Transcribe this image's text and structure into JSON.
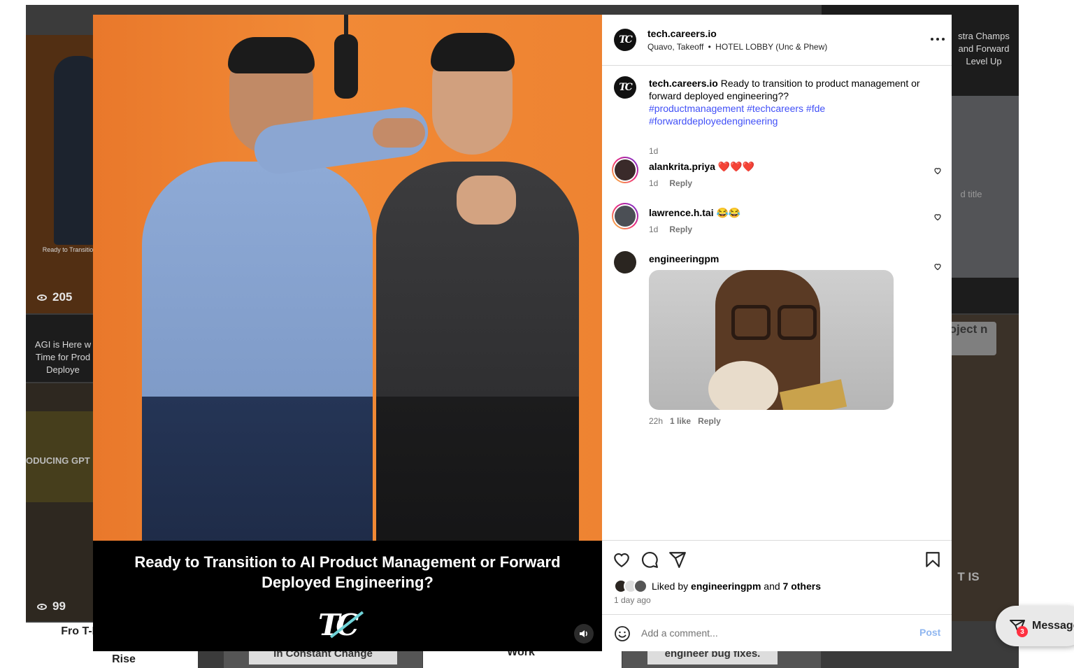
{
  "background": {
    "tiles": [
      {
        "text": "Ready to Transitio",
        "views": "205"
      },
      {
        "text": "AGI is Here w Time for Prod Deploye",
        "views": ""
      },
      {
        "text": "ODUCING GPT",
        "views": "99"
      },
      {
        "text": "stra Champs and Forward Level Up",
        "views": ""
      },
      {
        "text": "d title",
        "views": ""
      },
      {
        "text": "oject n",
        "views": ""
      },
      {
        "text": "T IS",
        "views": ""
      }
    ],
    "bottom_captions": [
      "Fro T-Mo",
      "Rise",
      "in Constant Change",
      "Work",
      "engineer bug fixes."
    ]
  },
  "post": {
    "username": "tech.careers.io",
    "audio": "Quavo, Takeoff",
    "audio_separator": "•",
    "audio_track": "HOTEL LOBBY (Unc & Phew)",
    "avatar_text": "TC",
    "video_caption": "Ready to Transition to AI Product Management or Forward Deployed Engineering?",
    "video_logo": "TC"
  },
  "caption": {
    "username": "tech.careers.io",
    "text": "Ready to transition to product management or forward deployed engineering??",
    "hashtags": "#productmanagement #techcareers #fde #forwarddeployedengineering",
    "time": "1d"
  },
  "comments": [
    {
      "username": "alankrita.priya",
      "text": "❤️❤️❤️",
      "time": "1d",
      "likes": "",
      "reply": "Reply"
    },
    {
      "username": "lawrence.h.tai",
      "text": "😂😂",
      "time": "1d",
      "likes": "",
      "reply": "Reply"
    },
    {
      "username": "engineeringpm",
      "text": "",
      "time": "22h",
      "likes": "1 like",
      "reply": "Reply"
    }
  ],
  "likes": {
    "prefix": "Liked by",
    "first_user": "engineeringpm",
    "conj": "and",
    "others": "7 others",
    "time_ago": "1 day ago"
  },
  "add_comment": {
    "placeholder": "Add a comment...",
    "post_label": "Post"
  },
  "messages": {
    "label": "Messages",
    "badge": "3"
  },
  "colors": {
    "hashtag": "#4150f7",
    "post_button": "#8fb6f0",
    "video_bg": "#ee8332",
    "badge": "#ff3040"
  }
}
